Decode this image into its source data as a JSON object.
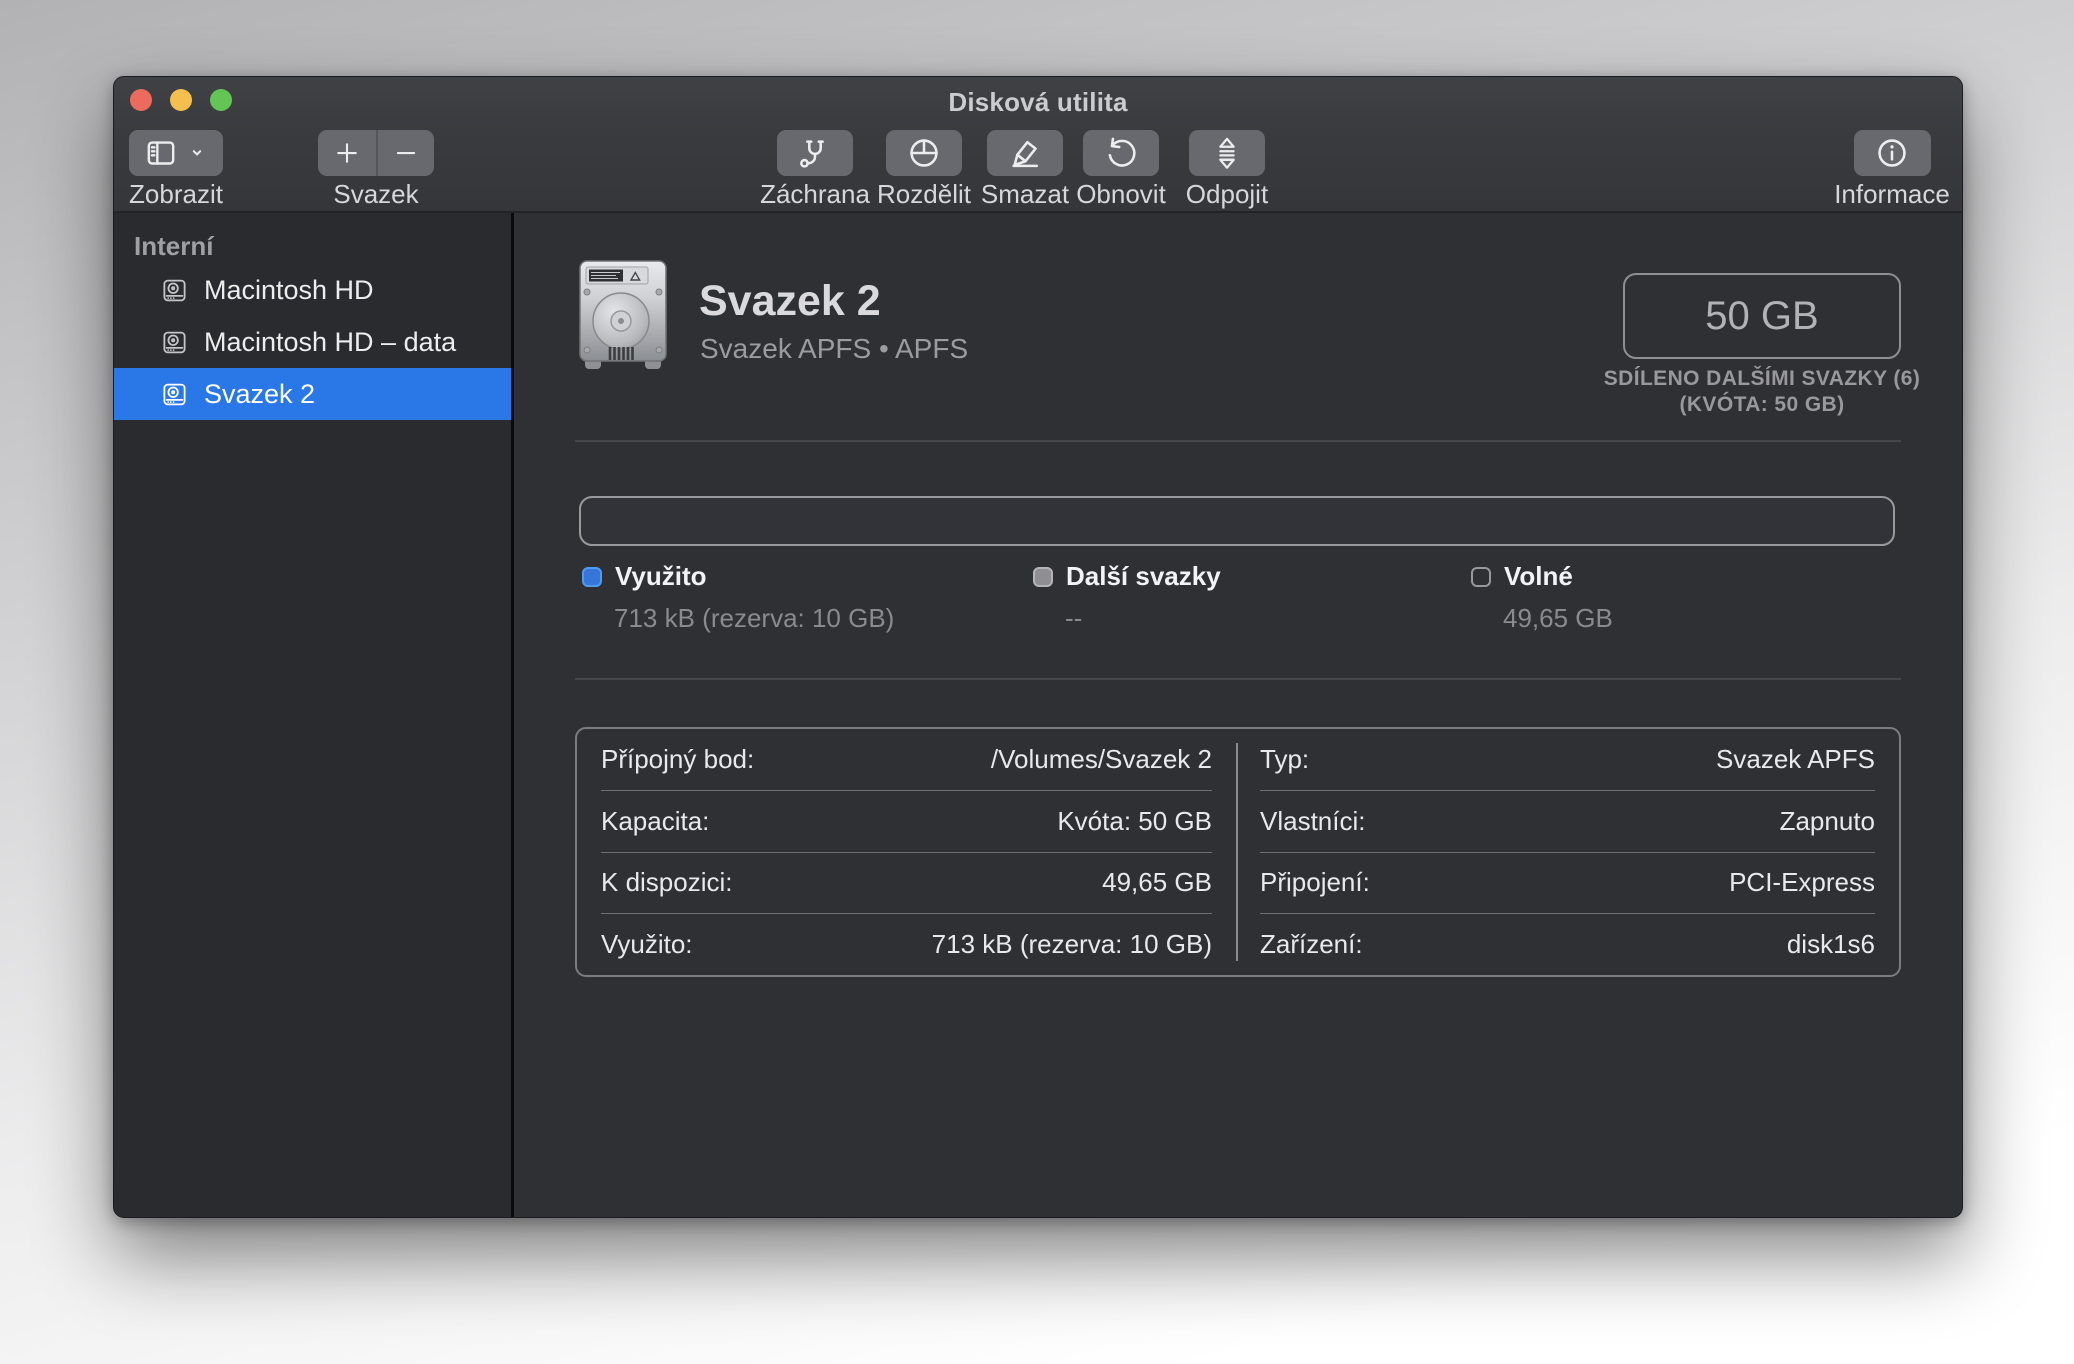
{
  "window": {
    "title": "Disková utilita"
  },
  "toolbar": {
    "view": {
      "label": "Zobrazit"
    },
    "volume": {
      "label": "Svazek"
    },
    "actions": [
      {
        "id": "first-aid",
        "label": "Záchrana"
      },
      {
        "id": "partition",
        "label": "Rozdělit"
      },
      {
        "id": "erase",
        "label": "Smazat"
      },
      {
        "id": "restore",
        "label": "Obnovit"
      },
      {
        "id": "unmount",
        "label": "Odpojit"
      }
    ],
    "info": {
      "label": "Informace"
    }
  },
  "sidebar": {
    "section": "Interní",
    "items": [
      {
        "label": "Macintosh HD",
        "selected": false
      },
      {
        "label": "Macintosh HD – data",
        "selected": false
      },
      {
        "label": "Svazek 2",
        "selected": true
      }
    ]
  },
  "main": {
    "volume_title": "Svazek 2",
    "volume_subtitle": "Svazek APFS • APFS",
    "size_box": {
      "size": "50 GB",
      "caption_line1": "SDÍLENO DALŠÍMI SVAZKY (6)",
      "caption_line2": "(KVÓTA: 50 GB)"
    },
    "legend": [
      {
        "label": "Využito",
        "value": "713 kB (rezerva: 10 GB)",
        "swatch": "blue"
      },
      {
        "label": "Další svazky",
        "value": "--",
        "swatch": "gray"
      },
      {
        "label": "Volné",
        "value": "49,65 GB",
        "swatch": "outline"
      }
    ],
    "details": {
      "left": [
        {
          "label": "Přípojný bod:",
          "value": "/Volumes/Svazek 2"
        },
        {
          "label": "Kapacita:",
          "value": "Kvóta: 50 GB"
        },
        {
          "label": "K dispozici:",
          "value": "49,65 GB"
        },
        {
          "label": "Využito:",
          "value": "713 kB (rezerva: 10 GB)"
        }
      ],
      "right": [
        {
          "label": "Typ:",
          "value": "Svazek APFS"
        },
        {
          "label": "Vlastníci:",
          "value": "Zapnuto"
        },
        {
          "label": "Připojení:",
          "value": "PCI-Express"
        },
        {
          "label": "Zařízení:",
          "value": "disk1s6"
        }
      ]
    }
  },
  "colors": {
    "selection_blue": "#2a77e8",
    "legend_used_fill": "#3776d8",
    "legend_used_border": "#4e9cf2",
    "legend_other_fill": "#8e8e93",
    "legend_free_border": "#98989d",
    "traffic_red": "#ed6a5f",
    "traffic_yellow": "#f5bf4f",
    "traffic_green": "#62c554"
  }
}
